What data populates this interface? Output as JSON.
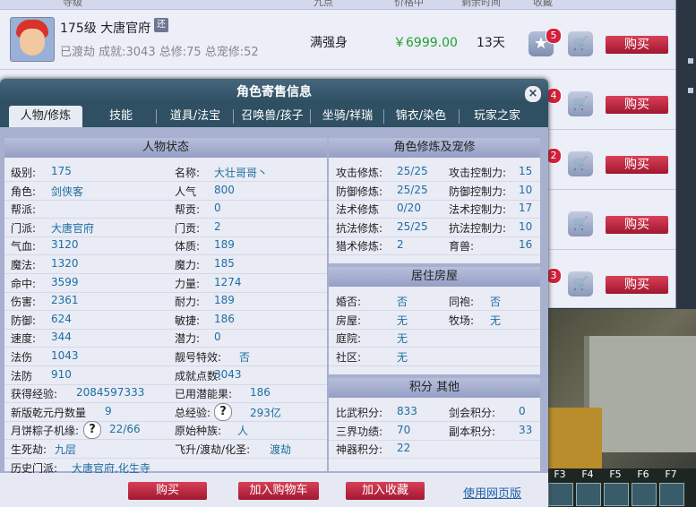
{
  "listing": {
    "header": [
      "寺级",
      "九点",
      "价格中",
      "剩余时间",
      "收藏"
    ],
    "row": {
      "title": "175级 大唐官府",
      "tag": "还",
      "sub": "已渡劫 成就:3043 总修:75 总宠修:52",
      "summary": "满强身",
      "price": "￥6999.00",
      "time": "13天"
    },
    "badges": [
      "5",
      "4",
      "2",
      "3"
    ],
    "buy_label": "购买"
  },
  "dialog": {
    "title": "角色寄售信息",
    "close": "×",
    "tabs": [
      "人物/修炼",
      "技能",
      "道具/法宝",
      "召唤兽/孩子",
      "坐骑/祥瑞",
      "锦衣/染色",
      "玩家之家"
    ],
    "status": {
      "title": "人物状态",
      "left": [
        {
          "label": "级别:",
          "value": "175"
        },
        {
          "label": "角色:",
          "value": "剑侠客"
        },
        {
          "label": "帮派:",
          "value": ""
        },
        {
          "label": "门派:",
          "value": "大唐官府"
        },
        {
          "label": "气血:",
          "value": "3120"
        },
        {
          "label": "魔法:",
          "value": "1320"
        },
        {
          "label": "命中:",
          "value": "3599"
        },
        {
          "label": "伤害:",
          "value": "2361"
        },
        {
          "label": "防御:",
          "value": "624"
        },
        {
          "label": "速度:",
          "value": "344"
        },
        {
          "label": "法伤",
          "value": "1043"
        },
        {
          "label": "法防",
          "value": "910"
        },
        {
          "label": "获得经验:",
          "value": "2084597333"
        },
        {
          "label": "新版乾元丹数量",
          "value": "9"
        },
        {
          "label": "月饼粽子机缘:",
          "value": "22/66"
        },
        {
          "label": "生死劫:",
          "value": "九层"
        },
        {
          "label": "历史门派:",
          "value": "大唐官府,化生寺"
        }
      ],
      "right": [
        {
          "label": "名称:",
          "value": "大壮哥哥丶"
        },
        {
          "label": "人气",
          "value": "800"
        },
        {
          "label": "帮贡:",
          "value": "0"
        },
        {
          "label": "门贡:",
          "value": "2"
        },
        {
          "label": "体质:",
          "value": "189"
        },
        {
          "label": "魔力:",
          "value": "185"
        },
        {
          "label": "力量:",
          "value": "1274"
        },
        {
          "label": "耐力:",
          "value": "189"
        },
        {
          "label": "敏捷:",
          "value": "186"
        },
        {
          "label": "潜力:",
          "value": "0"
        },
        {
          "label": "靓号特效:",
          "value": "否"
        },
        {
          "label": "成就点数:",
          "value": "3043"
        },
        {
          "label": "已用潜能果:",
          "value": "186"
        },
        {
          "label": "总经验:",
          "value": "293亿"
        },
        {
          "label": "原始种族:",
          "value": "人"
        },
        {
          "label": "飞升/渡劫/化圣:",
          "value": "渡劫"
        }
      ]
    },
    "cultivation": {
      "title": "角色修炼及宠修",
      "rows": [
        {
          "l1": "攻击修炼:",
          "v1": "25/25",
          "l2": "攻击控制力:",
          "v2": "15"
        },
        {
          "l1": "防御修炼:",
          "v1": "25/25",
          "l2": "防御控制力:",
          "v2": "10"
        },
        {
          "l1": "法术修炼",
          "v1": "0/20",
          "l2": "法术控制力:",
          "v2": "17"
        },
        {
          "l1": "抗法修炼:",
          "v1": "25/25",
          "l2": "抗法控制力:",
          "v2": "10"
        },
        {
          "l1": "猎术修炼:",
          "v1": "2",
          "l2": "育兽:",
          "v2": "16"
        }
      ]
    },
    "house": {
      "title": "居住房屋",
      "rows": [
        {
          "l1": "婚否:",
          "v1": "否",
          "l2": "同袍:",
          "v2": "否"
        },
        {
          "l1": "房屋:",
          "v1": "无",
          "l2": "牧场:",
          "v2": "无"
        },
        {
          "l1": "庭院:",
          "v1": "无",
          "l2": "",
          "v2": ""
        },
        {
          "l1": "社区:",
          "v1": "无",
          "l2": "",
          "v2": ""
        }
      ]
    },
    "points": {
      "title": "积分 其他",
      "rows": [
        {
          "l1": "比武积分:",
          "v1": "833",
          "l2": "剑会积分:",
          "v2": "0"
        },
        {
          "l1": "三界功绩:",
          "v1": "70",
          "l2": "副本积分:",
          "v2": "33"
        },
        {
          "l1": "神器积分:",
          "v1": "22",
          "l2": "",
          "v2": ""
        }
      ]
    },
    "footer": {
      "buy": "购买",
      "add_cart": "加入购物车",
      "add_fav": "加入收藏",
      "web_link": "使用网页版"
    }
  },
  "hotkeys": [
    "F3",
    "F4",
    "F5",
    "F6",
    "F7"
  ]
}
